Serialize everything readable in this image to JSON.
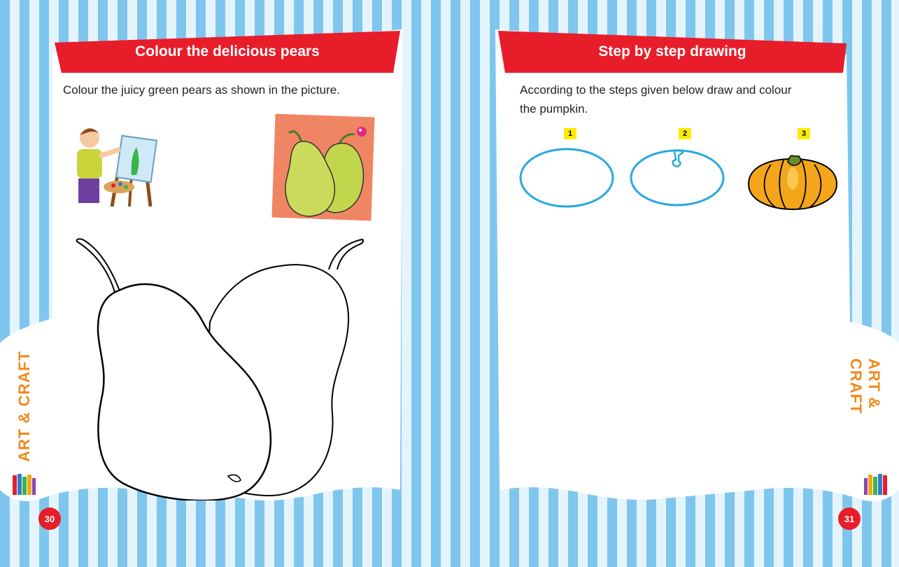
{
  "left_page": {
    "title": "Colour the delicious pears",
    "instruction": "Colour the juicy green pears as shown in the picture.",
    "side_label": "ART & CRAFT",
    "page_number": "30"
  },
  "right_page": {
    "title": "Step by step drawing",
    "instruction_line1": "According to the steps given below draw and colour",
    "instruction_line2": "the pumpkin.",
    "steps": [
      "1",
      "2",
      "3"
    ],
    "side_label": "ART & CRAFT",
    "page_number": "31"
  },
  "colors": {
    "banner_red": "#e81d2a",
    "stripe_blue": "#7ec6ee",
    "side_label_orange": "#f08a1c",
    "pear_green": "#c9dc5a",
    "pumpkin_orange": "#f3a61a",
    "step_outline_blue": "#29a8e0"
  },
  "icons": [
    "boy-painting-illustration",
    "pear-reference-card",
    "pear-outline-drawing",
    "pumpkin-step-ellipse",
    "pumpkin-colored",
    "book-stack-icon"
  ]
}
